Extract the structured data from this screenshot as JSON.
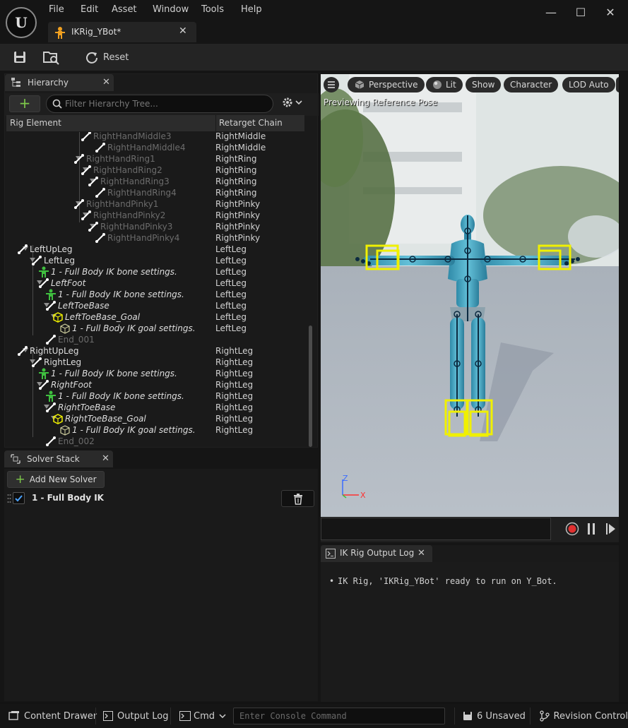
{
  "window": {
    "logo_text": "U",
    "menu": [
      "File",
      "Edit",
      "Asset",
      "Window",
      "Tools",
      "Help"
    ],
    "doc_tab": "IKRig_YBot*",
    "controls": {
      "minimize": "—",
      "maximize": "☐",
      "close": "✕"
    }
  },
  "toolbar": {
    "reset_label": "Reset"
  },
  "hierarchy": {
    "tab_label": "Hierarchy",
    "close": "✕",
    "add": "+",
    "filter_placeholder": "Filter Hierarchy Tree...",
    "columns": [
      "Rig Element",
      "Retarget Chain"
    ],
    "rows": [
      {
        "name": "RightHandMiddle3",
        "chain": "RightMiddle"
      },
      {
        "name": "RightHandMiddle4",
        "chain": "RightMiddle"
      },
      {
        "name": "RightHandRing1",
        "chain": "RightRing"
      },
      {
        "name": "RightHandRing2",
        "chain": "RightRing"
      },
      {
        "name": "RightHandRing3",
        "chain": "RightRing"
      },
      {
        "name": "RightHandRing4",
        "chain": "RightRing"
      },
      {
        "name": "RightHandPinky1",
        "chain": "RightPinky"
      },
      {
        "name": "RightHandPinky2",
        "chain": "RightPinky"
      },
      {
        "name": "RightHandPinky3",
        "chain": "RightPinky"
      },
      {
        "name": "RightHandPinky4",
        "chain": "RightPinky"
      },
      {
        "name": "LeftUpLeg",
        "chain": "LeftLeg"
      },
      {
        "name": "LeftLeg",
        "chain": "LeftLeg"
      },
      {
        "name": "1 - Full Body IK bone settings.",
        "chain": "LeftLeg"
      },
      {
        "name": "LeftFoot",
        "chain": "LeftLeg"
      },
      {
        "name": "1 - Full Body IK bone settings.",
        "chain": "LeftLeg"
      },
      {
        "name": "LeftToeBase",
        "chain": "LeftLeg"
      },
      {
        "name": "LeftToeBase_Goal",
        "chain": "LeftLeg"
      },
      {
        "name": "1 - Full Body IK goal settings.",
        "chain": "LeftLeg"
      },
      {
        "name": "End_001",
        "chain": ""
      },
      {
        "name": "RightUpLeg",
        "chain": "RightLeg"
      },
      {
        "name": "RightLeg",
        "chain": "RightLeg"
      },
      {
        "name": "1 - Full Body IK bone settings.",
        "chain": "RightLeg"
      },
      {
        "name": "RightFoot",
        "chain": "RightLeg"
      },
      {
        "name": "1 - Full Body IK bone settings.",
        "chain": "RightLeg"
      },
      {
        "name": "RightToeBase",
        "chain": "RightLeg"
      },
      {
        "name": "RightToeBase_Goal",
        "chain": "RightLeg"
      },
      {
        "name": "1 - Full Body IK goal settings.",
        "chain": "RightLeg"
      },
      {
        "name": "End_002",
        "chain": ""
      }
    ]
  },
  "solver_stack": {
    "tab_label": "Solver Stack",
    "close": "✕",
    "add_label": "Add New Solver",
    "add_plus": "+",
    "solvers": [
      {
        "label": "1 - Full Body IK",
        "enabled": true
      }
    ]
  },
  "viewport": {
    "buttons": {
      "perspective": "Perspective",
      "lit": "Lit",
      "show": "Show",
      "character": "Character",
      "lod": "LOD Auto"
    },
    "preview_label": "Previewing Reference Pose",
    "axis_z": "Z",
    "axis_x": "X"
  },
  "output_log": {
    "tab_label": "IK Rig Output Log",
    "close": "✕",
    "lines": [
      "IK Rig, 'IKRig_YBot' ready to run on Y_Bot."
    ]
  },
  "statusbar": {
    "content_drawer": "Content Drawer",
    "output_log": "Output Log",
    "cmd": "Cmd",
    "console_placeholder": "Enter Console Command",
    "unsaved": "6 Unsaved",
    "revision_control": "Revision Control"
  },
  "colors": {
    "accent_green": "#7ec94a",
    "goal_yellow": "#f0f000",
    "record_red": "#e03030"
  }
}
